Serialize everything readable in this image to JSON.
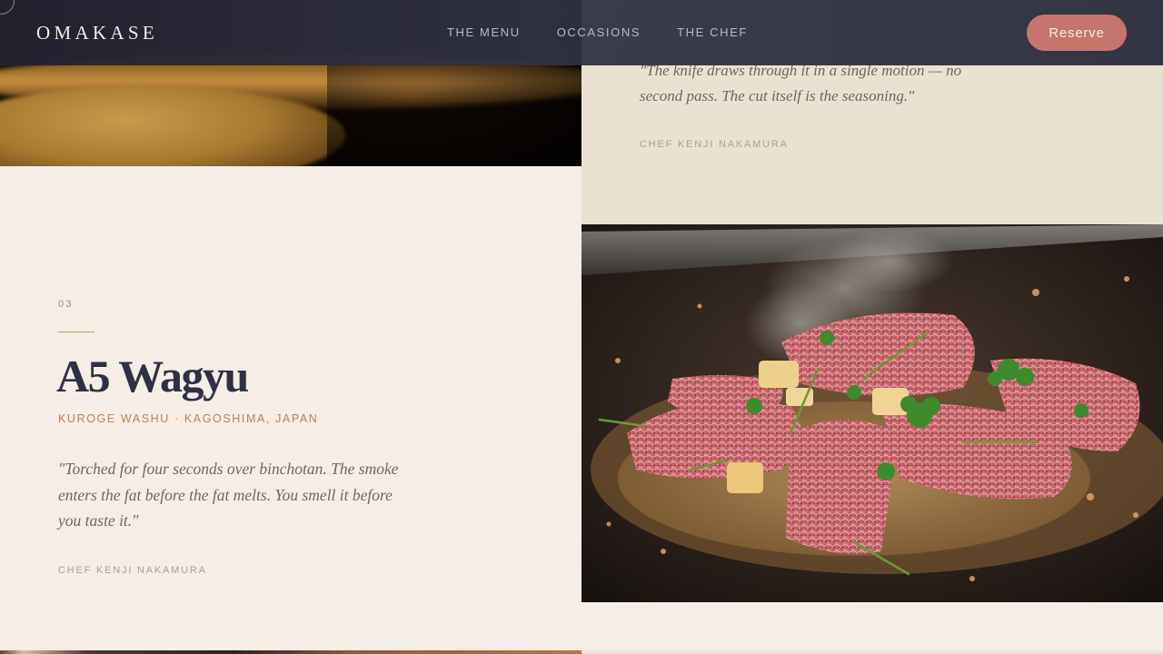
{
  "brand": {
    "logo": "OMAKASE"
  },
  "nav": {
    "links": [
      "THE MENU",
      "OCCASIONS",
      "THE CHEF"
    ],
    "cta": "Reserve"
  },
  "prev_item": {
    "quote": "\"The knife draws through it in a single motion — no second pass. The cut itself is the seasoning.\"",
    "attribution": "CHEF KENJI NAKAMURA"
  },
  "item": {
    "number": "03",
    "title": "A5 Wagyu",
    "origin": "KUROGE WASHU · KAGOSHIMA, JAPAN",
    "quote": "\"Torched for four seconds over binchotan. The smoke enters the fat before the fat melts. You smell it before you taste it.\"",
    "attribution": "CHEF KENJI NAKAMURA"
  },
  "colors": {
    "accent": "#c5756b",
    "navy": "#2e3044",
    "gold": "#b7845a",
    "cream": "#f5ede6",
    "sand": "#ebe1d2"
  }
}
